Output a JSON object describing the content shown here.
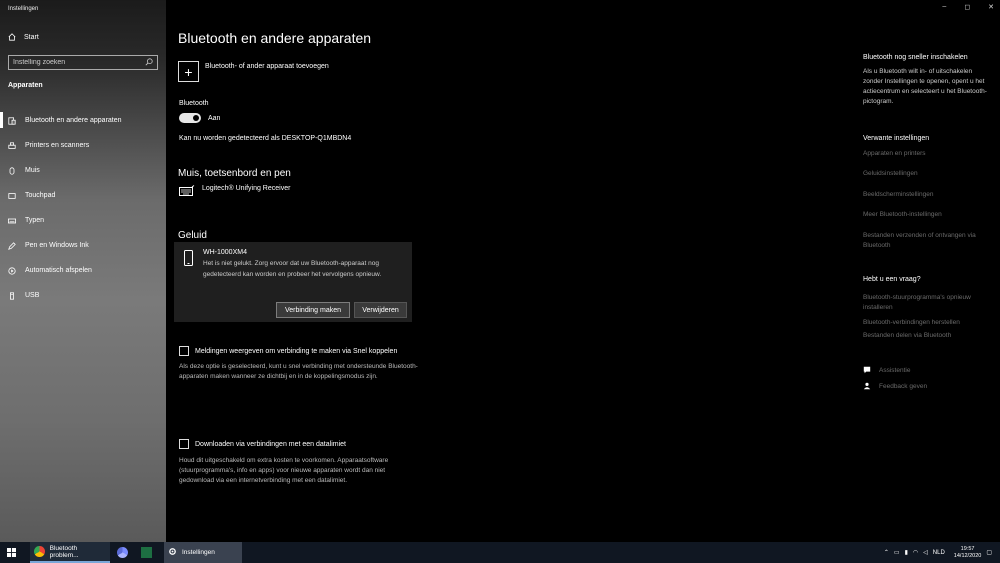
{
  "window": {
    "title": "Instellingen",
    "controls": {
      "minimize": "–",
      "maximize": "◻",
      "close": "✕"
    }
  },
  "nav": {
    "home_label": "Start",
    "search_placeholder": "Instelling zoeken",
    "section_title": "Apparaten",
    "items": [
      {
        "label": "Bluetooth en andere apparaten",
        "icon": "bluetooth-devices-icon",
        "active": true
      },
      {
        "label": "Printers en scanners",
        "icon": "printer-icon",
        "active": false
      },
      {
        "label": "Muis",
        "icon": "mouse-icon",
        "active": false
      },
      {
        "label": "Touchpad",
        "icon": "touchpad-icon",
        "active": false
      },
      {
        "label": "Typen",
        "icon": "keyboard-icon",
        "active": false
      },
      {
        "label": "Pen en Windows Ink",
        "icon": "pen-icon",
        "active": false
      },
      {
        "label": "Automatisch afspelen",
        "icon": "autoplay-icon",
        "active": false
      },
      {
        "label": "USB",
        "icon": "usb-icon",
        "active": false
      }
    ]
  },
  "main": {
    "title": "Bluetooth en andere apparaten",
    "add_device_label": "Bluetooth- of ander apparaat toevoegen",
    "bluetooth_label": "Bluetooth",
    "toggle_state": "Aan",
    "discoverable_text": "Kan nu worden gedetecteerd als DESKTOP-Q1MBDN4",
    "mouse_section": {
      "title": "Muis, toetsenbord en pen",
      "device": "Logitech® Unifying Receiver"
    },
    "sound_section": {
      "title": "Geluid",
      "device": "WH-1000XM4",
      "message": "Het is niet gelukt. Zorg ervoor dat uw Bluetooth-apparaat nog gedetecteerd kan worden en probeer het vervolgens opnieuw.",
      "connect_button": "Verbinding maken",
      "remove_button": "Verwijderen"
    },
    "swift_pair": {
      "label": "Meldingen weergeven om verbinding te maken via Snel koppelen",
      "description": "Als deze optie is geselecteerd, kunt u snel verbinding met ondersteunde Bluetooth-apparaten maken wanneer ze dichtbij en in de koppelingsmodus zijn."
    },
    "metered": {
      "label": "Downloaden via verbindingen met een datalimiet",
      "description": "Houd dit uitgeschakeld om extra kosten te voorkomen. Apparaatsoftware (stuurprogramma's, info en apps) voor nieuwe apparaten wordt dan niet gedownload via een internetverbinding met een datalimiet."
    }
  },
  "right": {
    "faster_title": "Bluetooth nog sneller inschakelen",
    "faster_text": "Als u Bluetooth wilt in- of uitschakelen zonder Instellingen te openen, opent u het actiecentrum en selecteert u het Bluetooth-pictogram.",
    "related_title": "Verwante instellingen",
    "related_links": [
      "Apparaten en printers",
      "Geluidsinstellingen",
      "Beeldscherminstellingen",
      "Meer Bluetooth-instellingen",
      "Bestanden verzenden of ontvangen via Bluetooth"
    ],
    "question_title": "Hebt u een vraag?",
    "question_links": [
      "Bluetooth-stuurprogramma's opnieuw installeren",
      "Bluetooth-verbindingen herstellen",
      "Bestanden delen via Bluetooth"
    ],
    "assist_label": "Assistentie",
    "feedback_label": "Feedback geven"
  },
  "taskbar": {
    "chrome_label": "Bluetooth problem...",
    "settings_label": "Instellingen",
    "tray_lang": "NLD",
    "time": "19:57",
    "date": "14/12/2020"
  },
  "colors": {
    "background": "#000000",
    "nav_background": "#6b6b6b",
    "card_background": "#1f1f1f",
    "link_muted": "#6a6a6a",
    "taskbar": "#101722"
  }
}
